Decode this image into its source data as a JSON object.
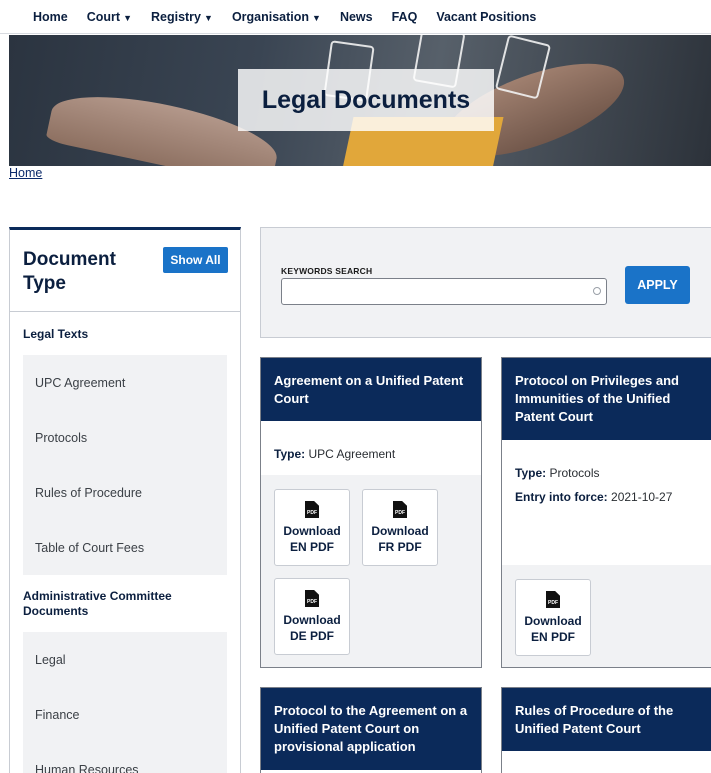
{
  "nav": {
    "items": [
      {
        "label": "Home",
        "caret": ""
      },
      {
        "label": "Court",
        "caret": "▼"
      },
      {
        "label": "Registry",
        "caret": "▼"
      },
      {
        "label": "Organisation",
        "caret": "▼"
      },
      {
        "label": "News",
        "caret": ""
      },
      {
        "label": "FAQ",
        "caret": ""
      },
      {
        "label": "Vacant Positions",
        "caret": ""
      }
    ]
  },
  "hero": {
    "title": "Legal Documents"
  },
  "breadcrumb": {
    "home": "Home"
  },
  "sidebar": {
    "title": "Document Type",
    "show_all": "Show All",
    "groups": [
      {
        "title": "Legal Texts",
        "items": [
          "UPC Agreement",
          "Protocols",
          "Rules of Procedure",
          "Table of Court Fees"
        ]
      },
      {
        "title": "Administrative Committee Documents",
        "items": [
          "Legal",
          "Finance",
          "Human Resources"
        ]
      }
    ]
  },
  "search": {
    "label": "KEYWORDS SEARCH",
    "value": "",
    "placeholder": "",
    "apply": "APPLY"
  },
  "cards": [
    {
      "title": "Agreement on a Unified Patent Court",
      "type_label": "Type:",
      "type_value": "UPC Agreement",
      "downloads": [
        {
          "icon": "PDF",
          "label": "Download EN PDF"
        },
        {
          "icon": "PDF",
          "label": "Download FR PDF"
        },
        {
          "icon": "PDF",
          "label": "Download DE PDF"
        }
      ]
    },
    {
      "title": "Protocol on Privileges and Immunities of the Unified Patent Court",
      "type_label": "Type:",
      "type_value": "Protocols",
      "entry_label": "Entry into force:",
      "entry_value": "2021-10-27",
      "downloads": [
        {
          "icon": "PDF",
          "label": "Download EN PDF"
        }
      ]
    },
    {
      "title": "Protocol to the Agreement on a Unified Patent Court on provisional application"
    },
    {
      "title": "Rules of Procedure of the Unified Patent Court"
    }
  ]
}
